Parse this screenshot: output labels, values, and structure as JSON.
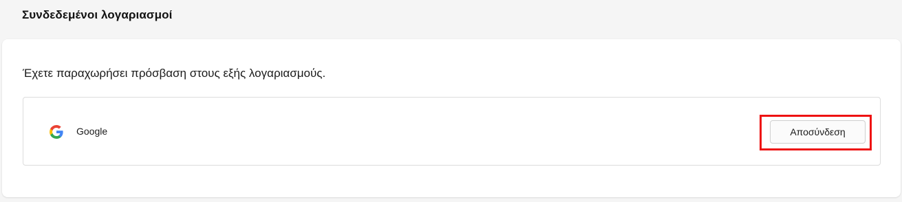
{
  "section": {
    "title": "Συνδεδεμένοι λογαριασμοί"
  },
  "panel": {
    "description": "Έχετε παραχωρήσει πρόσβαση στους εξής λογαριασμούς."
  },
  "accounts": [
    {
      "provider": "Google",
      "icon": "google-logo-icon",
      "action_label": "Αποσύνδεση"
    }
  ],
  "colors": {
    "highlight": "#ee1111",
    "google_blue": "#4285F4",
    "google_red": "#EA4335",
    "google_yellow": "#FBBC05",
    "google_green": "#34A853"
  }
}
